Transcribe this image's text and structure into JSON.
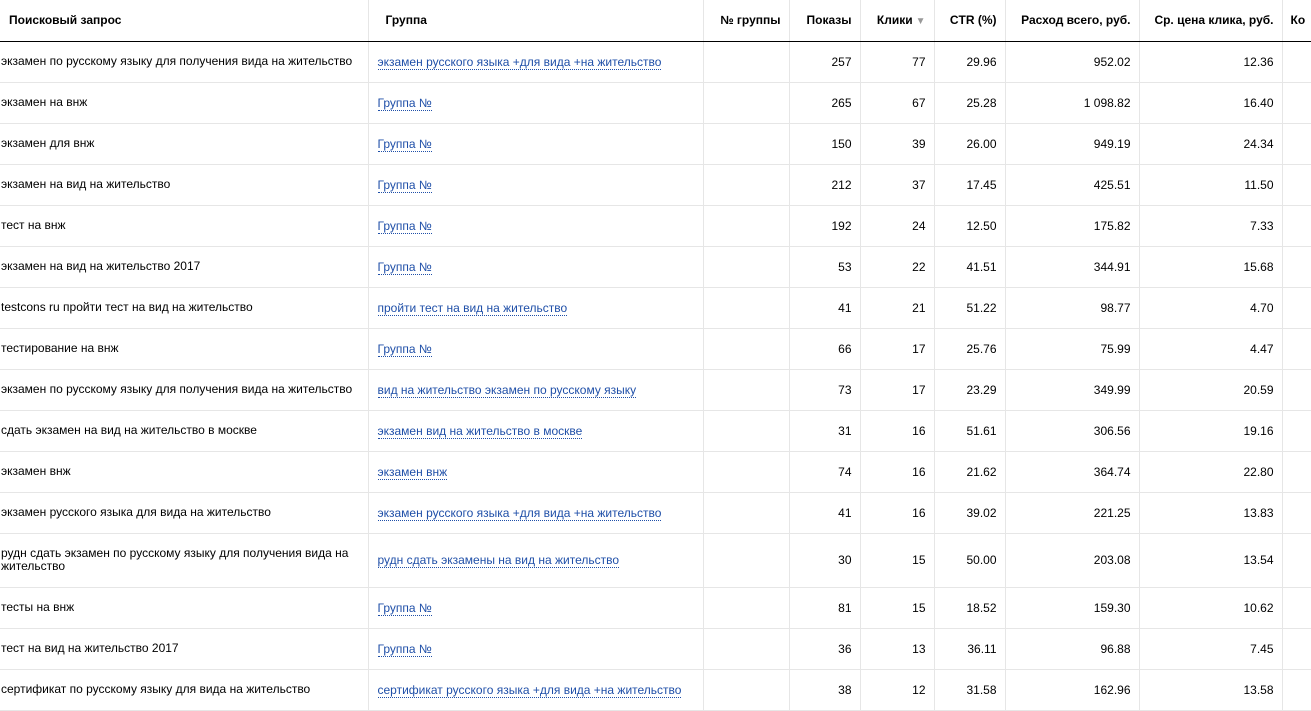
{
  "table": {
    "headers": {
      "query": "Поисковый запрос",
      "group": "Группа",
      "group_no": "№ группы",
      "shows": "Показы",
      "clicks": "Клики",
      "ctr": "CTR (%)",
      "cost": "Расход всего, руб.",
      "avg_cpc": "Ср. цена клика, руб.",
      "extra": "Ко"
    },
    "sort_icon": "sort-desc-icon",
    "rows": [
      {
        "query": "экзамен по русскому языку для получения вида на жительство",
        "group": "экзамен русского языка +для вида +на жительство",
        "group_no": "",
        "shows": "257",
        "clicks": "77",
        "ctr": "29.96",
        "cost": "952.02",
        "cpc": "12.36"
      },
      {
        "query": "экзамен на внж",
        "group": "Группа №",
        "group_no": "",
        "shows": "265",
        "clicks": "67",
        "ctr": "25.28",
        "cost": "1 098.82",
        "cpc": "16.40"
      },
      {
        "query": "экзамен для внж",
        "group": "Группа №",
        "group_no": "",
        "shows": "150",
        "clicks": "39",
        "ctr": "26.00",
        "cost": "949.19",
        "cpc": "24.34"
      },
      {
        "query": "экзамен на вид на жительство",
        "group": "Группа №",
        "group_no": "",
        "shows": "212",
        "clicks": "37",
        "ctr": "17.45",
        "cost": "425.51",
        "cpc": "11.50"
      },
      {
        "query": "тест на внж",
        "group": "Группа №",
        "group_no": "",
        "shows": "192",
        "clicks": "24",
        "ctr": "12.50",
        "cost": "175.82",
        "cpc": "7.33"
      },
      {
        "query": "экзамен на вид на жительство 2017",
        "group": "Группа №",
        "group_no": "",
        "shows": "53",
        "clicks": "22",
        "ctr": "41.51",
        "cost": "344.91",
        "cpc": "15.68"
      },
      {
        "query": "testcons ru пройти тест на вид на жительство",
        "group": "пройти тест на вид на жительство",
        "group_no": "",
        "shows": "41",
        "clicks": "21",
        "ctr": "51.22",
        "cost": "98.77",
        "cpc": "4.70"
      },
      {
        "query": "тестирование на внж",
        "group": "Группа №",
        "group_no": "",
        "shows": "66",
        "clicks": "17",
        "ctr": "25.76",
        "cost": "75.99",
        "cpc": "4.47"
      },
      {
        "query": "экзамен по русскому языку для получения вида на жительство",
        "group": "вид на жительство экзамен по русскому языку",
        "group_no": "",
        "shows": "73",
        "clicks": "17",
        "ctr": "23.29",
        "cost": "349.99",
        "cpc": "20.59"
      },
      {
        "query": "сдать экзамен на вид на жительство в москве",
        "group": "экзамен вид на жительство в москве",
        "group_no": "",
        "shows": "31",
        "clicks": "16",
        "ctr": "51.61",
        "cost": "306.56",
        "cpc": "19.16"
      },
      {
        "query": "экзамен внж",
        "group": "экзамен внж",
        "group_no": "",
        "shows": "74",
        "clicks": "16",
        "ctr": "21.62",
        "cost": "364.74",
        "cpc": "22.80"
      },
      {
        "query": "экзамен русского языка для вида на жительство",
        "group": "экзамен русского языка +для вида +на жительство",
        "group_no": "",
        "shows": "41",
        "clicks": "16",
        "ctr": "39.02",
        "cost": "221.25",
        "cpc": "13.83"
      },
      {
        "query": "рудн сдать экзамен по русскому языку для получения вида на жительство",
        "group": "рудн сдать экзамены на вид на жительство",
        "group_no": "",
        "shows": "30",
        "clicks": "15",
        "ctr": "50.00",
        "cost": "203.08",
        "cpc": "13.54",
        "tall": true
      },
      {
        "query": "тесты на внж",
        "group": "Группа №",
        "group_no": "",
        "shows": "81",
        "clicks": "15",
        "ctr": "18.52",
        "cost": "159.30",
        "cpc": "10.62"
      },
      {
        "query": "тест на вид на жительство 2017",
        "group": "Группа №",
        "group_no": "",
        "shows": "36",
        "clicks": "13",
        "ctr": "36.11",
        "cost": "96.88",
        "cpc": "7.45"
      },
      {
        "query": "сертификат по русскому языку для вида на жительство",
        "group": "сертификат русского языка +для вида +на жительство",
        "group_no": "",
        "shows": "38",
        "clicks": "12",
        "ctr": "31.58",
        "cost": "162.96",
        "cpc": "13.58"
      }
    ]
  }
}
